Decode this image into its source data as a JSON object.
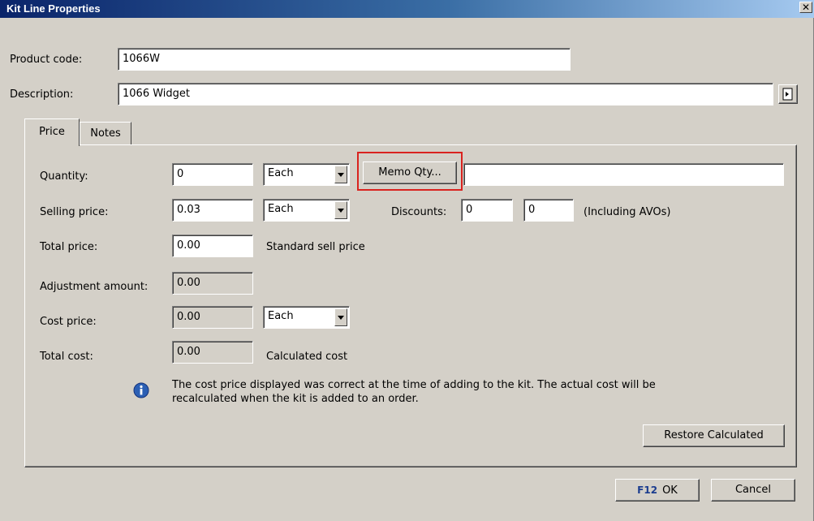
{
  "window": {
    "title": "Kit Line Properties",
    "close_label": "✕"
  },
  "header": {
    "product_code_label": "Product code:",
    "product_code_value": "1066W",
    "description_label": "Description:",
    "description_value": "1066 Widget"
  },
  "tabs": [
    {
      "label": "Price"
    },
    {
      "label": "Notes"
    }
  ],
  "price": {
    "quantity_label": "Quantity:",
    "quantity_value": "0",
    "quantity_unit": "Each",
    "memo_qty_button": "Memo Qty...",
    "memo_qty_value": "",
    "selling_price_label": "Selling price:",
    "selling_price_value": "0.03",
    "selling_price_unit": "Each",
    "discounts_label": "Discounts:",
    "discount1": "0",
    "discount2": "0",
    "discounts_note": "(Including AVOs)",
    "total_price_label": "Total price:",
    "total_price_value": "0.00",
    "total_price_note": "Standard sell price",
    "adjustment_label": "Adjustment amount:",
    "adjustment_value": "0.00",
    "cost_price_label": "Cost price:",
    "cost_price_value": "0.00",
    "cost_price_unit": "Each",
    "total_cost_label": "Total cost:",
    "total_cost_value": "0.00",
    "total_cost_note": "Calculated cost",
    "info_line1": "The cost price displayed was correct at the time of adding to the kit. The actual cost will be",
    "info_line2": "recalculated when the kit is added to an order.",
    "restore_button": "Restore Calculated"
  },
  "footer": {
    "ok_key": "F12",
    "ok_label": "OK",
    "cancel_label": "Cancel"
  },
  "colors": {
    "highlight": "#d9231f",
    "title_bar": "#0a246a",
    "info_icon": "#2b5fb4"
  },
  "icons": {
    "close": "close-icon",
    "lookup": "lookup-icon",
    "info": "info-icon",
    "dropdown": "chevron-down-icon"
  }
}
